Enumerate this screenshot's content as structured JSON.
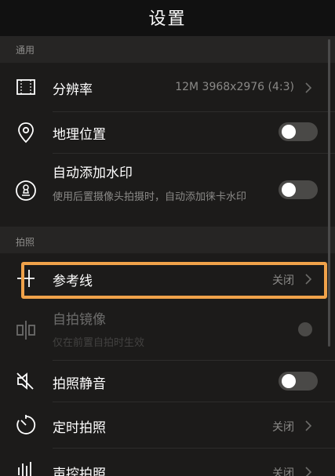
{
  "header": {
    "title": "设置"
  },
  "sections": {
    "general": "通用",
    "photo": "拍照"
  },
  "rows": {
    "resolution": {
      "label": "分辨率",
      "value": "12M 3968x2976 (4:3)",
      "icon": "resolution-icon"
    },
    "location": {
      "label": "地理位置",
      "icon": "location-pin-icon",
      "toggle": false
    },
    "watermark": {
      "label": "自动添加水印",
      "desc": "使用后置摄像头拍摄时，自动添加徕卡水印",
      "icon": "stamp-icon",
      "toggle": false
    },
    "grid": {
      "label": "参考线",
      "value": "关闭",
      "icon": "grid-icon"
    },
    "mirror": {
      "label": "自拍镜像",
      "desc": "仅在前置自拍时生效",
      "icon": "mirror-icon",
      "toggle": false,
      "disabled": true
    },
    "mute": {
      "label": "拍照静音",
      "icon": "speaker-mute-icon",
      "toggle": false
    },
    "timer": {
      "label": "定时拍照",
      "value": "关闭",
      "icon": "timer-icon"
    },
    "voice": {
      "label": "声控拍照",
      "value": "关闭",
      "icon": "voice-icon"
    }
  },
  "colors": {
    "background": "#1c1b1a",
    "section": "#262524",
    "highlight": "#f0a24a",
    "toggle_off": "#4a4947"
  }
}
